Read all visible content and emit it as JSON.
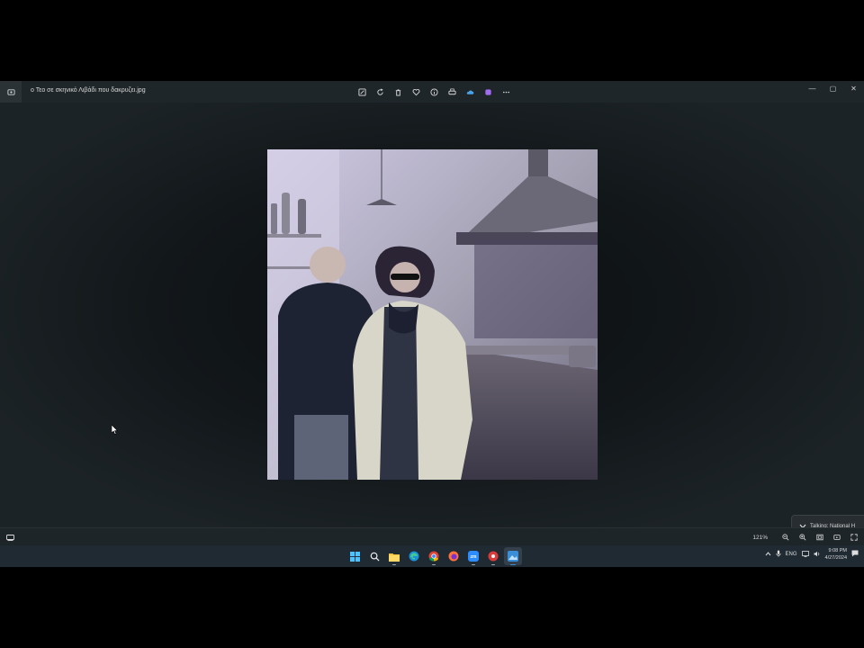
{
  "window": {
    "filename": "ο Τεο σε σκηνικό Λιβάδι που δακρυζει.jpg",
    "toolbar": [
      "edit-icon",
      "rotate-icon",
      "delete-icon",
      "favorite-icon",
      "info-icon",
      "print-icon",
      "cloud-icon",
      "copilot-icon",
      "more-icon"
    ],
    "controls": {
      "minimize": "—",
      "maximize": "▢",
      "close": "✕"
    }
  },
  "notification": {
    "text": "Talking: National H"
  },
  "statusbar": {
    "zoom": "121%"
  },
  "taskbar": {
    "apps": [
      "windows-start-icon",
      "search-icon",
      "file-explorer-icon",
      "edge-icon",
      "chrome-icon",
      "firefox-icon",
      "zoom-icon",
      "app-icon",
      "photos-icon"
    ],
    "tray": {
      "language": "ENG",
      "time": "9:08 PM",
      "date": "4/27/2024"
    }
  },
  "colors": {
    "accent": "#3a8fd9",
    "background": "#1c2326",
    "taskbar": "#202a33"
  }
}
